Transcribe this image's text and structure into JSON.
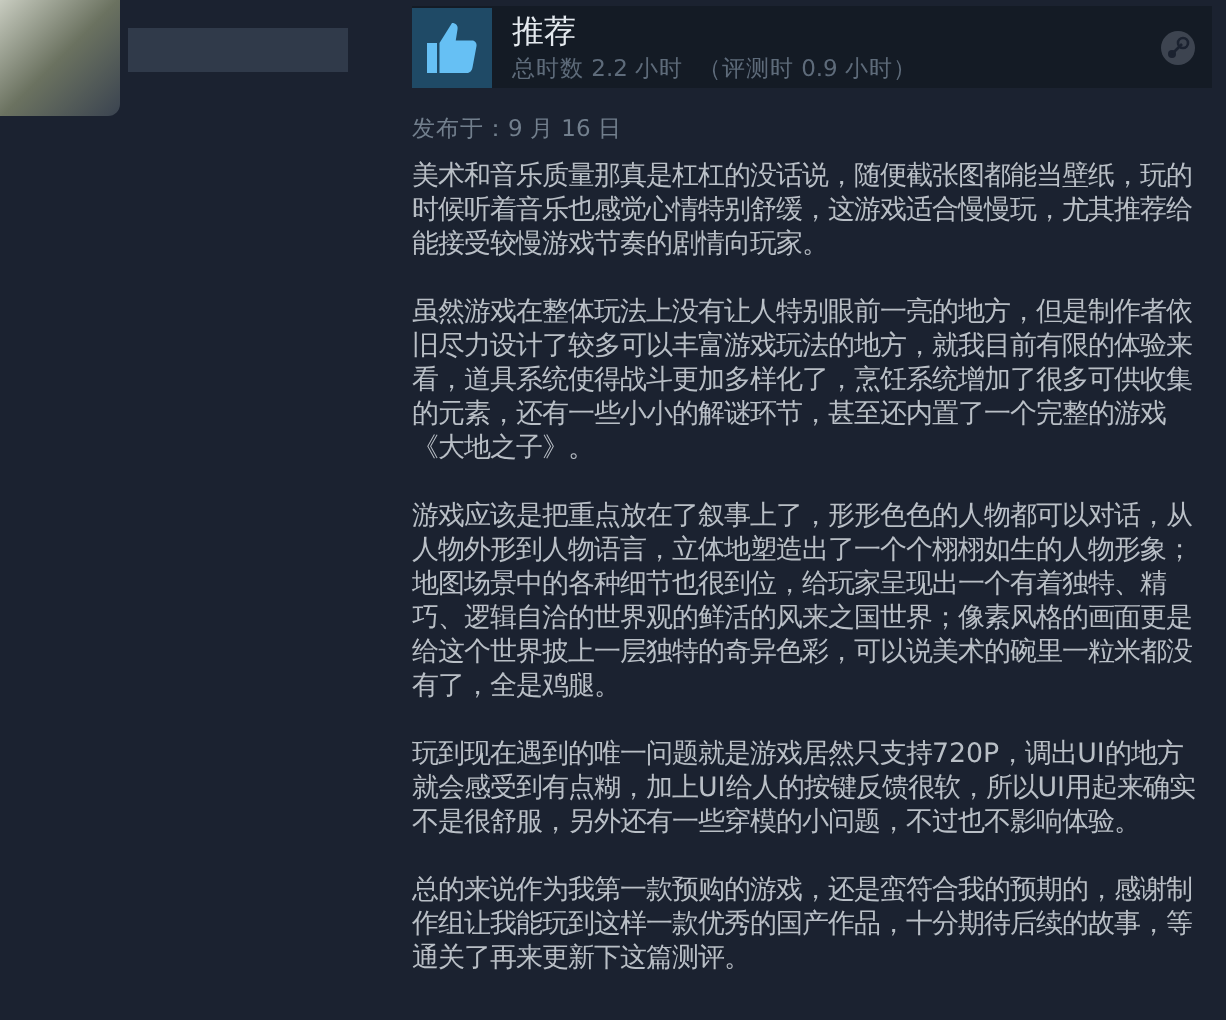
{
  "review": {
    "verdict": "推荐",
    "recommended": true,
    "hours": "总时数 2.2 小时",
    "review_hours": "（评测时 0.9 小时）",
    "posted": "发布于：9 月 16 日",
    "paragraphs": [
      "美术和音乐质量那真是杠杠的没话说，随便截张图都能当壁纸，玩的时候听着音乐也感觉心情特别舒缓，这游戏适合慢慢玩，尤其推荐给能接受较慢游戏节奏的剧情向玩家。",
      "虽然游戏在整体玩法上没有让人特别眼前一亮的地方，但是制作者依旧尽力设计了较多可以丰富游戏玩法的地方，就我目前有限的体验来看，道具系统使得战斗更加多样化了，烹饪系统增加了很多可供收集的元素，还有一些小小的解谜环节，甚至还内置了一个完整的游戏《大地之子》。",
      "游戏应该是把重点放在了叙事上了，形形色色的人物都可以对话，从人物外形到人物语言，立体地塑造出了一个个栩栩如生的人物形象；地图场景中的各种细节也很到位，给玩家呈现出一个有着独特、精巧、逻辑自洽的世界观的鲜活的风来之国世界；像素风格的画面更是给这个世界披上一层独特的奇异色彩，可以说美术的碗里一粒米都没有了，全是鸡腿。",
      "玩到现在遇到的唯一问题就是游戏居然只支持720P，调出UI的地方就会感受到有点糊，加上UI给人的按键反馈很软，所以UI用起来确实不是很舒服，另外还有一些穿模的小问题，不过也不影响体验。",
      "总的来说作为我第一款预购的游戏，还是蛮符合我的预期的，感谢制作组让我能玩到这样一款优秀的国产作品，十分期待后续的故事，等通关了再来更新下这篇测评。"
    ]
  }
}
